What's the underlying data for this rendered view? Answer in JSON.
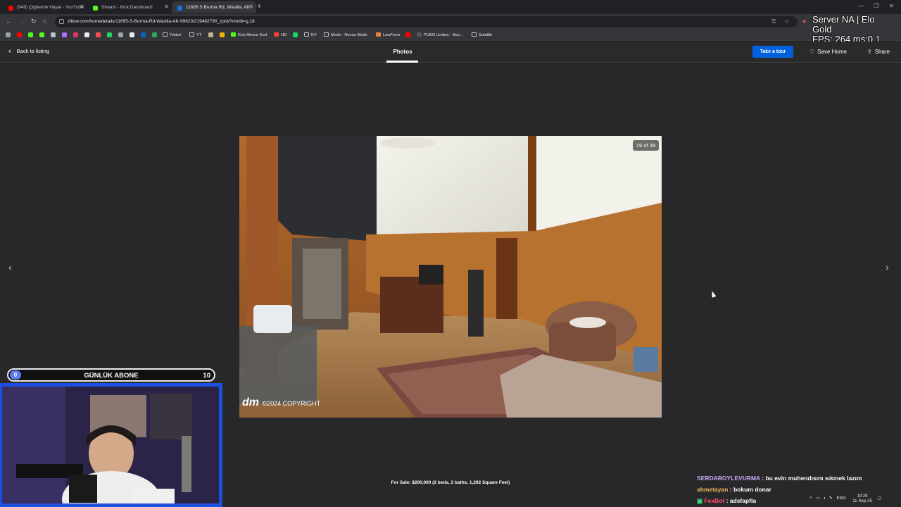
{
  "browser": {
    "tabs": [
      {
        "title": "(948) Çiğdemle Hayat - YouTube",
        "color": "#ff0000"
      },
      {
        "title": "Stream - Kick Dashboard",
        "color": "#53fc18"
      },
      {
        "title": "11695 S Burma Rd, Wasilla, AK",
        "color": "#1277e1"
      }
    ],
    "url": "zillow.com/homedetails/11695-S-Burma-Rd-Wasilla-AK-99623/219482790_zpid/?mmlb=g,18",
    "bookmarks": [
      {
        "label": "Twitch",
        "color": "#9146ff"
      },
      {
        "label": "YT",
        "color": "#9aa0a6"
      },
      {
        "label": "Kick Abone Kod",
        "color": "#53fc18"
      },
      {
        "label": "HD",
        "color": "#ff3c3c"
      },
      {
        "label": "EV",
        "color": "#9aa0a6"
      },
      {
        "label": "Mods - Nexus Mods",
        "color": "#9aa0a6"
      },
      {
        "label": "LawForm",
        "color": "#e8823a"
      },
      {
        "label": "PUBG Umbra - Sea...",
        "color": "#222"
      },
      {
        "label": "Subtitle",
        "color": "#9aa0a6"
      }
    ],
    "overlay_stats": {
      "line1": "Server NA | Elo Gold",
      "line2": "FPS: 264 ms:0.1"
    }
  },
  "header": {
    "back_label": "Back to listing",
    "photos_tab": "Photos",
    "tour_button": "Take a tour",
    "save_home": "Save Home",
    "share": "Share"
  },
  "gallery": {
    "counter": "19 of 39",
    "watermark_logo": "dm",
    "watermark_text": "©2024 COPYRIGHT",
    "caption": "For Sale: $200,000 (2 beds, 2 baths, 1,292 Square Feet)"
  },
  "stream": {
    "sub_count": "0",
    "sub_title": "GÜNLÜK ABONE",
    "sub_goal": "10",
    "chat": [
      {
        "user": "SERDAROYLEVURMA",
        "msg": "bu evin muhendısını sıkmek lazım"
      },
      {
        "user": "ahmetayan",
        "msg": "bokum donar"
      },
      {
        "user": "FexBot",
        "msg": "adsfapfla"
      }
    ]
  },
  "taskbar": {
    "lang": "ENG",
    "time": "19:29",
    "date": "11-Sep-25"
  }
}
